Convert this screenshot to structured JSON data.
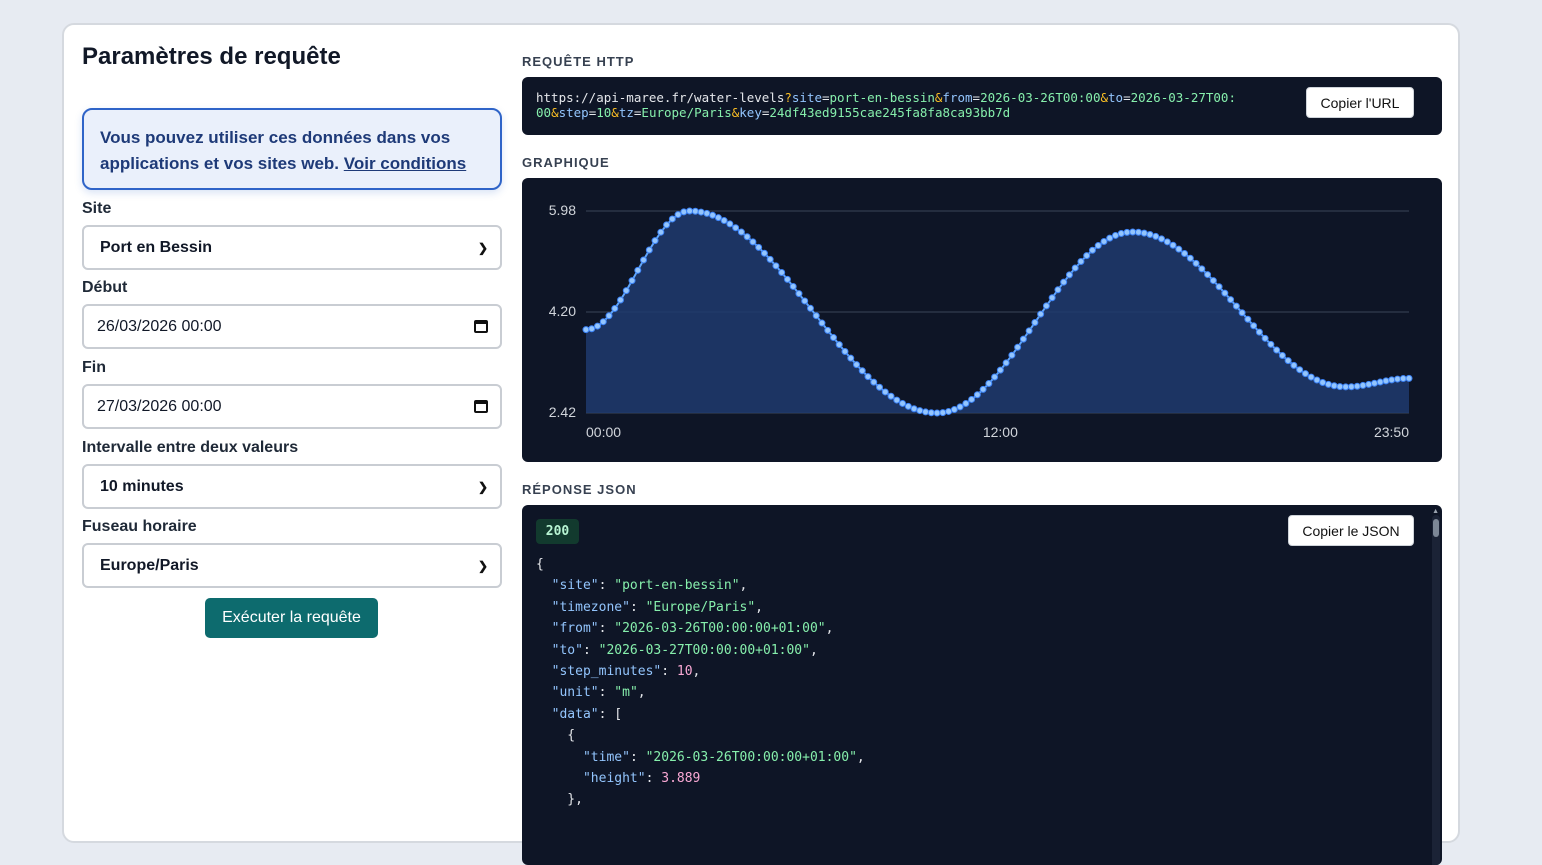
{
  "form": {
    "title": "Paramètres de requête",
    "notice_text": "Vous pouvez utiliser ces données dans vos applications et vos sites web.",
    "notice_link": "Voir conditions",
    "site_label": "Site",
    "site_value": "Port en Bessin",
    "start_label": "Début",
    "start_value": "26/03/2026 00:00",
    "end_label": "Fin",
    "end_value": "27/03/2026 00:00",
    "interval_label": "Intervalle entre deux valeurs",
    "interval_value": "10 minutes",
    "timezone_label": "Fuseau horaire",
    "timezone_value": "Europe/Paris",
    "run_button": "Exécuter la requête"
  },
  "request": {
    "section_label": "REQUÊTE HTTP",
    "base_url": "https://api-maree.fr/water-levels",
    "params": [
      {
        "key": "site",
        "value": "port-en-bessin"
      },
      {
        "key": "from",
        "value": "2026-03-26T00:00"
      },
      {
        "key": "to",
        "value": "2026-03-27T00:00"
      },
      {
        "key": "step",
        "value": "10"
      },
      {
        "key": "tz",
        "value": "Europe/Paris"
      },
      {
        "key": "key",
        "value": "24df43ed9155cae245fa8fa8ca93bb7d"
      }
    ],
    "copy_button": "Copier l'URL"
  },
  "chart_section_label": "GRAPHIQUE",
  "chart_data": {
    "type": "area",
    "title": "",
    "xlabel": "",
    "ylabel": "",
    "x_ticks": [
      "00:00",
      "12:00",
      "23:50"
    ],
    "y_ticks": [
      2.42,
      4.2,
      5.98
    ],
    "y_tick_labels": [
      "2.42",
      "4.20",
      "5.98"
    ],
    "ylim": [
      2.42,
      5.98
    ],
    "x_range": [
      "00:00",
      "23:50"
    ],
    "step_minutes": 10,
    "grid": true,
    "legend": "none",
    "line_color": "#60a5fa",
    "fill_color": "#1e3a6e",
    "series": [
      {
        "keypoints": [
          {
            "time": "00:00",
            "height": 3.889
          },
          {
            "time": "03:00",
            "height": 5.98
          },
          {
            "time": "10:10",
            "height": 2.42
          },
          {
            "time": "15:50",
            "height": 5.61
          },
          {
            "time": "22:00",
            "height": 2.88
          },
          {
            "time": "23:50",
            "height": 3.03
          }
        ]
      }
    ]
  },
  "response": {
    "section_label": "RÉPONSE JSON",
    "status": "200",
    "copy_button": "Copier le JSON",
    "site": "port-en-bessin",
    "timezone": "Europe/Paris",
    "from": "2026-03-26T00:00:00+01:00",
    "to": "2026-03-27T00:00:00+01:00",
    "step_minutes": 10,
    "unit": "m",
    "first_time": "2026-03-26T00:00:00+01:00",
    "first_height": 3.889
  },
  "colors": {
    "accent_button": "#0d6b6e",
    "notice_border": "#2f64c8",
    "dark_panel": "#0e1526"
  }
}
